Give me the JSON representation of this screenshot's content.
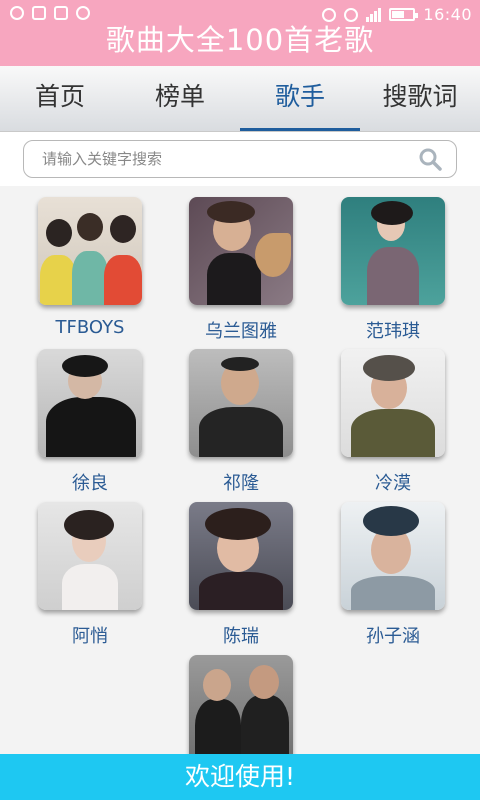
{
  "status_bar": {
    "time": "16:40",
    "battery_level": 0.6
  },
  "app": {
    "title": "歌曲大全100首老歌"
  },
  "tabs": [
    {
      "label": "首页",
      "active": false
    },
    {
      "label": "榜单",
      "active": false
    },
    {
      "label": "歌手",
      "active": true
    },
    {
      "label": "搜歌词",
      "active": false
    }
  ],
  "search": {
    "placeholder": "请输入关键字搜索"
  },
  "singers": [
    {
      "name": "TFBOYS"
    },
    {
      "name": "乌兰图雅"
    },
    {
      "name": "范玮琪"
    },
    {
      "name": "徐良"
    },
    {
      "name": "祁隆"
    },
    {
      "name": "冷漠"
    },
    {
      "name": "阿悄"
    },
    {
      "name": "陈瑞"
    },
    {
      "name": "孙子涵"
    },
    {
      "name": ""
    }
  ],
  "footer": {
    "text": "欢迎使用!"
  },
  "colors": {
    "title_bar": "#f7a6bf",
    "active_tab": "#1f5d9d",
    "singer_name": "#2b5b94",
    "footer": "#1ec8f2"
  }
}
